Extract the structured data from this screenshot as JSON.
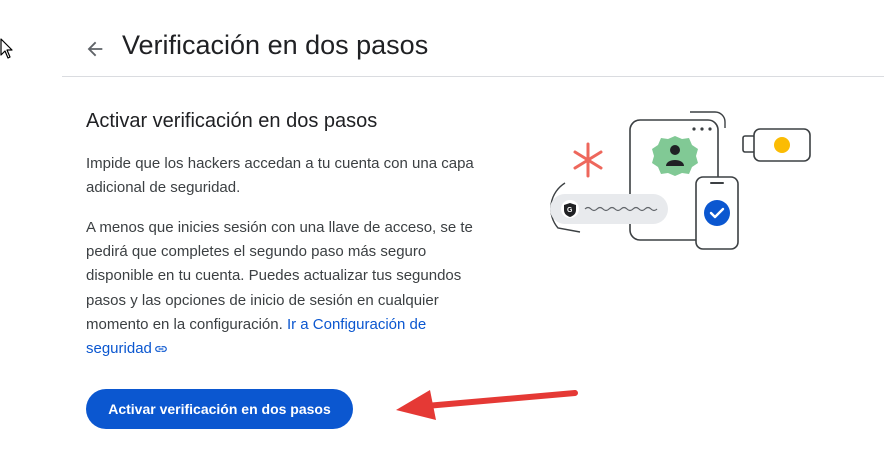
{
  "header": {
    "title": "Verificación en dos pasos"
  },
  "section": {
    "title": "Activar verificación en dos pasos",
    "intro": "Impide que los hackers accedan a tu cuenta con una capa adicional de seguridad.",
    "description": "A menos que inicies sesión con una llave de acceso, se te pedirá que completes el segundo paso más seguro disponible en tu cuenta. Puedes actualizar tus segundos pasos y las opciones de inicio de sesión en cualquier momento en la configuración.",
    "link_label": "Ir a Configuración de seguridad"
  },
  "actions": {
    "enable_label": "Activar verificación en dos pasos"
  },
  "colors": {
    "primary": "#0b57d0",
    "illustration_green": "#81c995",
    "illustration_red": "#ee675c",
    "illustration_yellow": "#fbbc04",
    "annotation_arrow": "#e53935"
  },
  "icons": {
    "back": "arrow-left-icon",
    "link": "link-icon",
    "cursor": "mouse-cursor-icon"
  }
}
